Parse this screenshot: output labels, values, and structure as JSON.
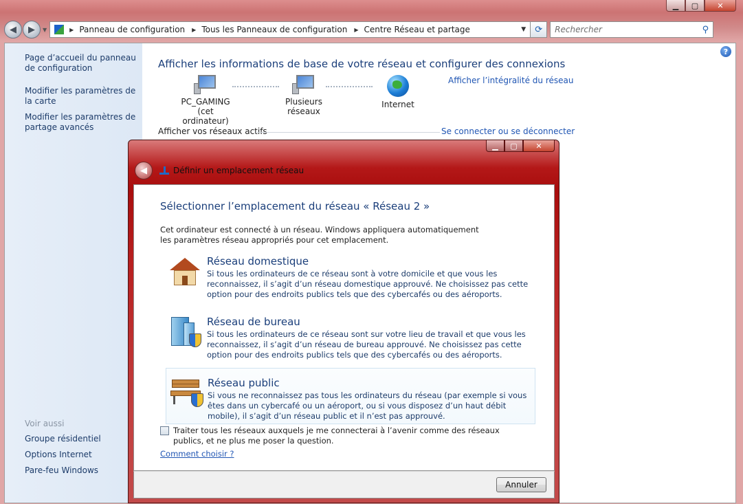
{
  "window": {
    "minimize": "▁",
    "maximize": "▢",
    "close": "✕"
  },
  "nav": {
    "back_icon": "arrow-left-icon",
    "forward_icon": "arrow-right-icon",
    "breadcrumb": [
      "Panneau de configuration",
      "Tous les Panneaux de configuration",
      "Centre Réseau et partage"
    ],
    "search_placeholder": "Rechercher"
  },
  "sidebar": {
    "links": [
      "Page d’accueil du panneau de configuration",
      "Modifier les paramètres de la carte",
      "Modifier les paramètres de partage avancés"
    ],
    "see_also_label": "Voir aussi",
    "see_also": [
      "Groupe résidentiel",
      "Options Internet",
      "Pare-feu Windows"
    ]
  },
  "main": {
    "title": "Afficher les informations de base de votre réseau et configurer des connexions",
    "full_map_link": "Afficher l’intégralité du réseau",
    "nodes": {
      "computer_name": "PC_GAMING",
      "computer_sub": "(cet ordinateur)",
      "networks": "Plusieurs réseaux",
      "internet": "Internet"
    },
    "active_networks_label": "Afficher vos réseaux actifs",
    "connect_link": "Se connecter ou se déconnecter"
  },
  "dialog": {
    "title": "Définir un emplacement réseau",
    "heading": "Sélectionner l’emplacement du réseau « Réseau  2 »",
    "intro": "Cet ordinateur est connecté à un réseau. Windows appliquera automatiquement les paramètres réseau appropriés pour cet emplacement.",
    "options": [
      {
        "name": "Réseau domestique",
        "desc": "Si tous les ordinateurs de ce réseau sont à votre domicile et que vous les reconnaissez, il s’agit d’un réseau domestique approuvé. Ne choisissez pas cette option pour des endroits publics tels que des cybercafés ou des aéroports.",
        "icon": "house-icon"
      },
      {
        "name": "Réseau de bureau",
        "desc": "Si tous les ordinateurs de ce réseau sont sur votre lieu de travail et que vous les reconnaissez, il s’agit d’un réseau de bureau approuvé. Ne choisissez pas cette option pour des endroits publics tels que des cybercafés ou des aéroports.",
        "icon": "office-building-icon"
      },
      {
        "name": "Réseau public",
        "desc": "Si vous ne reconnaissez pas tous les ordinateurs du réseau (par exemple si vous êtes dans un cybercafé ou un aéroport, ou si vous disposez d’un haut débit mobile), il s’agit d’un réseau public et il n’est pas approuvé.",
        "icon": "park-bench-icon"
      }
    ],
    "checkbox_label": "Traiter tous les réseaux auxquels je me connecterai à l’avenir comme des réseaux publics, et ne plus me poser la question.",
    "checkbox_checked": false,
    "help_link": "Comment choisir ?",
    "cancel_label": "Annuler"
  },
  "colors": {
    "frame_accent": "#b41818",
    "link": "#1f55b3",
    "heading": "#1a3e7a"
  }
}
